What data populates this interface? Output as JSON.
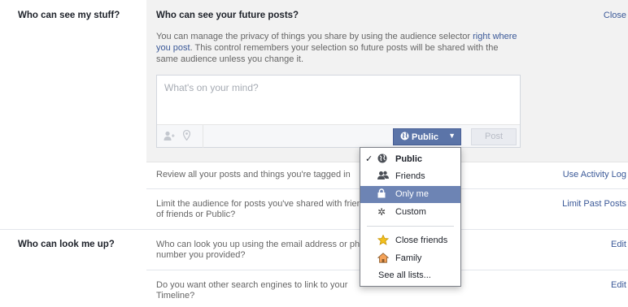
{
  "rows": {
    "who_can_see_label": "Who can see my stuff?",
    "who_can_look_label": "Who can look me up?"
  },
  "future_posts": {
    "title": "Who can see your future posts?",
    "close_label": "Close",
    "desc_before": "You can manage the privacy of things you share by using the audience selector ",
    "desc_link": "right where you post",
    "desc_after": ". This control remembers your selection so future posts will be shared with the same audience unless you change it."
  },
  "composer": {
    "placeholder": "What's on your mind?",
    "audience_label": "Public",
    "post_label": "Post"
  },
  "activity": {
    "text": "Review all your posts and things you're tagged in",
    "link": "Use Activity Log"
  },
  "limit": {
    "text_line1": "Limit the audience for posts you've shared with friends",
    "text_line2": "of friends or Public?",
    "link": "Limit Past Posts"
  },
  "email_lookup": {
    "text_line1": "Who can look you up using the email address or phone",
    "text_line2": "number you provided?",
    "link": "Edit"
  },
  "search_engines": {
    "text_line1": "Do you want other search engines to link to your",
    "text_line2": "Timeline?",
    "link": "Edit"
  },
  "audience_menu": {
    "items": [
      {
        "label": "Public",
        "icon": "globe-icon",
        "checked": true,
        "selected": false
      },
      {
        "label": "Friends",
        "icon": "friends-icon",
        "checked": false,
        "selected": false
      },
      {
        "label": "Only me",
        "icon": "lock-icon",
        "checked": false,
        "selected": true
      },
      {
        "label": "Custom",
        "icon": "gear-icon",
        "checked": false,
        "selected": false
      },
      {
        "label": "Close friends",
        "icon": "star-icon",
        "checked": false,
        "selected": false
      },
      {
        "label": "Family",
        "icon": "house-icon",
        "checked": false,
        "selected": false
      }
    ],
    "see_all": "See all lists...",
    "check_mark": "✓"
  },
  "colors": {
    "link": "#3b5998",
    "button": "#5b74a8",
    "highlight": "#6d84b4"
  }
}
